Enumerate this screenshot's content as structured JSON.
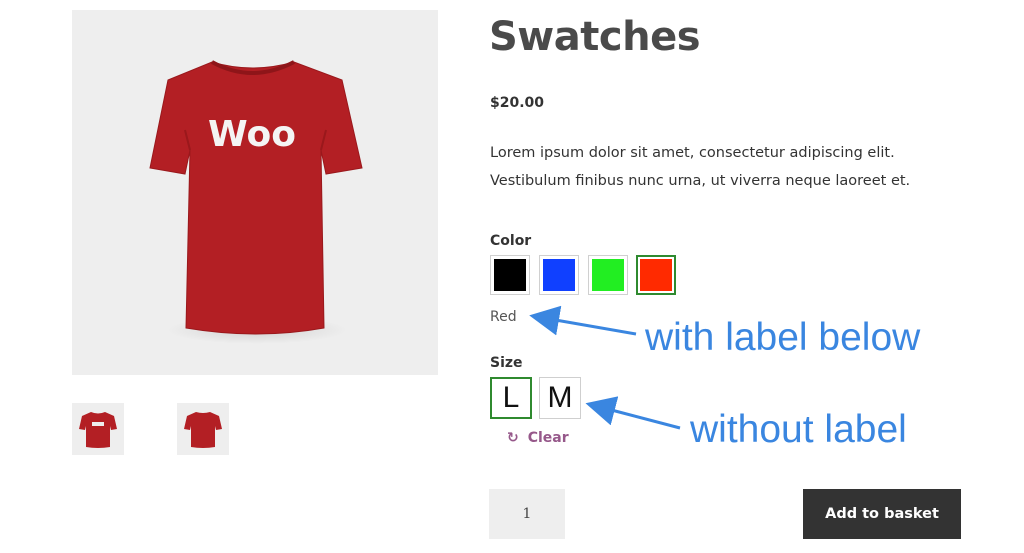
{
  "product": {
    "title": "Swatches",
    "price": "$20.00",
    "description_lines": [
      "Lorem ipsum dolor sit amet, consectetur adipiscing elit.",
      "Vestibulum finibus nunc urna, ut viverra neque laoreet et."
    ],
    "image_logo_text": "Woo",
    "image_color": "#b31f24"
  },
  "color": {
    "label": "Color",
    "selected_value": "Red",
    "swatches": [
      {
        "name": "Black",
        "hex": "#000000",
        "selected": false
      },
      {
        "name": "Blue",
        "hex": "#1040ff",
        "selected": false
      },
      {
        "name": "Green",
        "hex": "#22ee22",
        "selected": false
      },
      {
        "name": "Red",
        "hex": "#ff2a00",
        "selected": true
      }
    ]
  },
  "size": {
    "label": "Size",
    "options": [
      {
        "label": "L",
        "selected": true
      },
      {
        "label": "M",
        "selected": false
      }
    ],
    "clear_label": "Clear",
    "clear_icon": "refresh-icon"
  },
  "cart": {
    "quantity": "1",
    "add_label": "Add to basket"
  },
  "annotations": {
    "with_label": "with label below",
    "without_label": "without label"
  },
  "colors": {
    "selected_border": "#2f8a2f",
    "annotation": "#3a86e0",
    "clear_link": "#96588a",
    "button_bg": "#333333"
  }
}
